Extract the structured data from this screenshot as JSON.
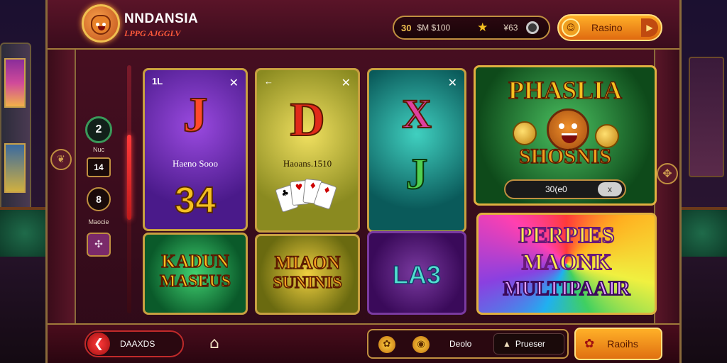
{
  "header": {
    "app_title": "NNDANSIA",
    "app_subtitle": "LPPG AJGGLV",
    "balance_primary": "30",
    "balance_secondary": "$M $100",
    "stars_value": "¥63",
    "action_button_label": "Rasino"
  },
  "side_panel": {
    "top_badge": "2",
    "top_badge_caption": "Nuc",
    "box_value": "14",
    "oval_value": "8",
    "label": "Maocie"
  },
  "cards": {
    "card1": {
      "corner": "1L",
      "letter": "J",
      "caption": "Haeno Sooo",
      "number": "34"
    },
    "card2": {
      "letter": "D",
      "caption": "Haoans.1510"
    },
    "card3": {
      "letter_top": "X",
      "letter_bottom": "J"
    },
    "card4": {
      "title": "PHASLIA",
      "subtitle": "SHOSNIS",
      "field_value": "30(e0",
      "field_button": "x"
    },
    "card5": {
      "line1": "KADUN",
      "line2": "MASEUS"
    },
    "card6": {
      "line1": "MIAON",
      "line2": "SUNINIS"
    },
    "card7": {
      "word": "LA3"
    },
    "card8": {
      "line1": "PERPIES",
      "line2": "MAONK",
      "line3": "MULTIPAAIR"
    }
  },
  "footer": {
    "back_label": "DAAXDS",
    "mid_text": "Deolo",
    "pill_label": "Prueser",
    "gold_label": "Raoihs"
  }
}
